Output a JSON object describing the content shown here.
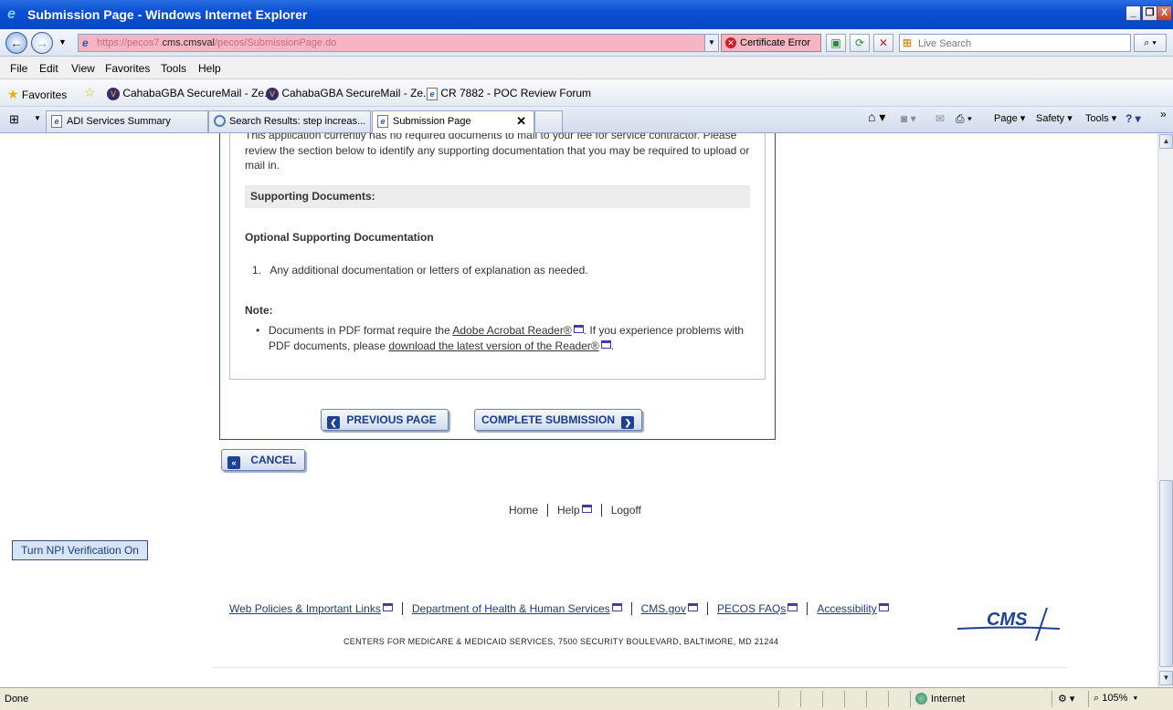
{
  "window": {
    "title": "Submission Page - Windows Internet Explorer",
    "controls": [
      "_",
      "❐",
      "X"
    ]
  },
  "address_bar": {
    "url_prefix": "https://pecos7.",
    "url_host": "cms.cmsval",
    "url_suffix": "/pecos/SubmissionPage.do",
    "certificate_label": "Certificate Error",
    "search_placeholder": "Live Search"
  },
  "menu": [
    "File",
    "Edit",
    "View",
    "Favorites",
    "Tools",
    "Help"
  ],
  "favorites_bar": {
    "favorites_label": "Favorites",
    "items": [
      "CahabaGBA SecureMail - Ze...",
      "CahabaGBA SecureMail - Ze...",
      "CR 7882 - POC Review Forum"
    ]
  },
  "tabs": [
    {
      "label": "ADI Services Summary"
    },
    {
      "label": "Search Results: step increas..."
    },
    {
      "label": "Submission Page"
    }
  ],
  "tab_tools": [
    "Page ▾",
    "Safety ▾",
    "Tools ▾"
  ],
  "content": {
    "intro_partial": "This application currently has no required documents to mail to your fee for service contractor. Please review the section below to identify any supporting documentation that you may be required to upload or mail in.",
    "supporting_docs_heading": "Supporting Documents:",
    "optional_heading": "Optional Supporting Documentation",
    "optional_items": [
      "1.   Any additional documentation or letters of explanation as needed."
    ],
    "note_heading": "Note:",
    "note": {
      "part1": "Documents in PDF format require the ",
      "link1": "Adobe Acrobat Reader®",
      "part2": ". If you experience problems with PDF documents, please ",
      "link2": "download the latest version of the Reader®",
      "part3": "."
    },
    "buttons": {
      "previous": "PREVIOUS PAGE",
      "complete": "COMPLETE SUBMISSION",
      "cancel": "CANCEL"
    },
    "nav_links": {
      "home": "Home",
      "help": "Help",
      "logoff": "Logoff"
    },
    "npi_button": "Turn NPI Verification On",
    "footer_links": [
      "Web Policies & Important Links",
      "Department of Health & Human Services",
      "CMS.gov",
      "PECOS FAQs",
      "Accessibility"
    ],
    "address": "CENTERS FOR MEDICARE & MEDICAID SERVICES, 7500 SECURITY BOULEVARD, BALTIMORE, MD 21244",
    "logo_text": "CMS"
  },
  "status_bar": {
    "status": "Done",
    "zone": "Internet",
    "zoom": "105%"
  },
  "colors": {
    "titlebar": "#0a4fd4",
    "url_error": "#f6b6c1",
    "button_text": "#1a3b86",
    "panel_border": "#2d4f86"
  }
}
